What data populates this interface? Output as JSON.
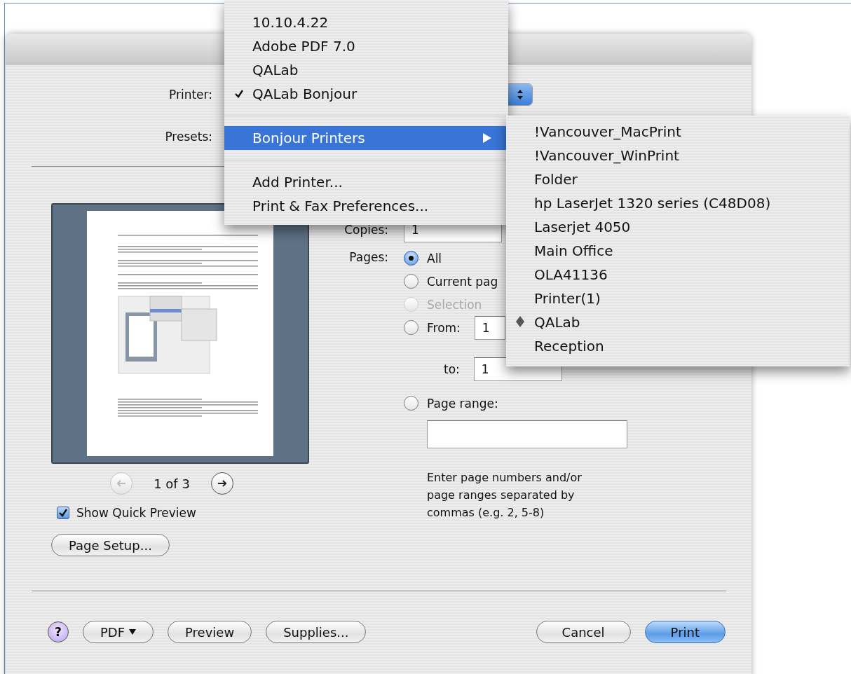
{
  "dialog": {
    "printer_label": "Printer:",
    "presets_label": "Presets:",
    "preview": {
      "page_indicator": "1 of 3",
      "nav": [
        {
          "kind": "prev",
          "disabled": true
        },
        {
          "kind": "next",
          "disabled": false
        }
      ]
    },
    "show_quick_preview": {
      "label": "Show Quick Preview",
      "checked": true
    },
    "page_setup_button": "Page Setup...",
    "copies": {
      "label": "Copies:",
      "value": "1"
    },
    "pages": {
      "label": "Pages:",
      "options": [
        {
          "kind": "plain",
          "label": "All",
          "selected": true,
          "disabled": false
        },
        {
          "kind": "plain",
          "label": "Current pag",
          "selected": false,
          "disabled": false
        },
        {
          "kind": "plain",
          "label": "Selection",
          "selected": false,
          "disabled": true
        },
        {
          "kind": "from",
          "label": "From:",
          "selected": false,
          "disabled": false,
          "value": "1",
          "to_label": "to:",
          "to_value": "1"
        },
        {
          "kind": "range",
          "label": "Page range:",
          "selected": false,
          "disabled": false
        }
      ],
      "hint": "Enter page numbers and/or page ranges separated by commas (e.g. 2, 5-8)"
    },
    "footer": {
      "help": "?",
      "left_buttons": [
        {
          "label": "PDF",
          "kind": "menu"
        },
        {
          "label": "Preview",
          "kind": "plain"
        },
        {
          "label": "Supplies...",
          "kind": "plain"
        }
      ],
      "right_buttons": [
        {
          "label": "Cancel",
          "default": false
        },
        {
          "label": "Print",
          "default": true
        }
      ]
    }
  },
  "printer_menu": {
    "items": [
      {
        "label": "10.10.4.22",
        "checked": false
      },
      {
        "label": "Adobe PDF 7.0",
        "checked": false
      },
      {
        "label": "QALab",
        "checked": false
      },
      {
        "label": "QALab Bonjour",
        "checked": true
      }
    ],
    "submenu_item": {
      "label": "Bonjour Printers",
      "selected": true
    },
    "actions": [
      "Add Printer...",
      "Print & Fax Preferences..."
    ]
  },
  "bonjour_menu": {
    "items": [
      {
        "label": "!Vancouver_MacPrint",
        "marked": false
      },
      {
        "label": "!Vancouver_WinPrint",
        "marked": false
      },
      {
        "label": "Folder",
        "marked": false
      },
      {
        "label": "hp LaserJet 1320 series (C48D08)",
        "marked": false
      },
      {
        "label": "Laserjet 4050",
        "marked": false
      },
      {
        "label": "Main Office",
        "marked": false
      },
      {
        "label": "OLA41136",
        "marked": false
      },
      {
        "label": "Printer(1)",
        "marked": false
      },
      {
        "label": "QALab",
        "marked": true
      },
      {
        "label": "Reception",
        "marked": false
      }
    ]
  }
}
